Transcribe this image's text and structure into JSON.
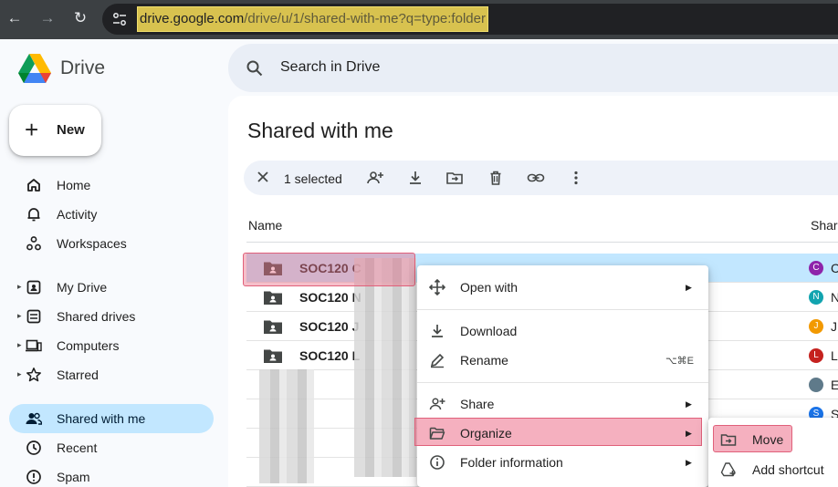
{
  "browser": {
    "url_host": "drive.google.com",
    "url_path": "/drive/u/1/shared-with-me?q=type:folder"
  },
  "app": {
    "brand": "Drive"
  },
  "new_button": {
    "label": "New"
  },
  "sidebar": {
    "items": [
      {
        "label": "Home",
        "icon": "home-icon"
      },
      {
        "label": "Activity",
        "icon": "bell-icon"
      },
      {
        "label": "Workspaces",
        "icon": "workspaces-icon"
      },
      {
        "label": "My Drive",
        "icon": "my-drive-icon"
      },
      {
        "label": "Shared drives",
        "icon": "shared-drives-icon"
      },
      {
        "label": "Computers",
        "icon": "computers-icon"
      },
      {
        "label": "Starred",
        "icon": "star-icon"
      },
      {
        "label": "Shared with me",
        "icon": "people-icon",
        "active": true
      },
      {
        "label": "Recent",
        "icon": "clock-icon"
      },
      {
        "label": "Spam",
        "icon": "spam-icon"
      }
    ]
  },
  "search": {
    "placeholder": "Search in Drive"
  },
  "page": {
    "title": "Shared with me"
  },
  "selection_bar": {
    "count_label": "1 selected"
  },
  "columns": {
    "name": "Name",
    "shared_by": "Shar"
  },
  "rows": [
    {
      "name": "SOC120 C",
      "avatar": "C",
      "avatar_color": "#8e24aa",
      "owner": "C",
      "selected": true
    },
    {
      "name": "SOC120 N",
      "avatar": "N",
      "avatar_color": "#12a4af",
      "owner": "N"
    },
    {
      "name": "SOC120 J",
      "avatar": "J",
      "avatar_color": "#f29900",
      "owner": "J"
    },
    {
      "name": "SOC120 L",
      "avatar": "L",
      "avatar_color": "#c5221f",
      "owner": "L"
    },
    {
      "name": "",
      "avatar": "",
      "avatar_color": "#5f7a8a",
      "owner": "E"
    },
    {
      "name": "",
      "avatar": "S",
      "avatar_color": "#1a73e8",
      "owner": "S"
    }
  ],
  "context_menu": {
    "open_with": "Open with",
    "download": "Download",
    "rename": "Rename",
    "rename_shortcut": "⌥⌘E",
    "share": "Share",
    "organize": "Organize",
    "folder_information": "Folder information"
  },
  "submenu": {
    "move": "Move",
    "add_shortcut": "Add shortcut"
  },
  "colors": {
    "accent": "#c2e7ff",
    "highlight": "#ec708a",
    "url_highlight": "#d8c24f"
  }
}
